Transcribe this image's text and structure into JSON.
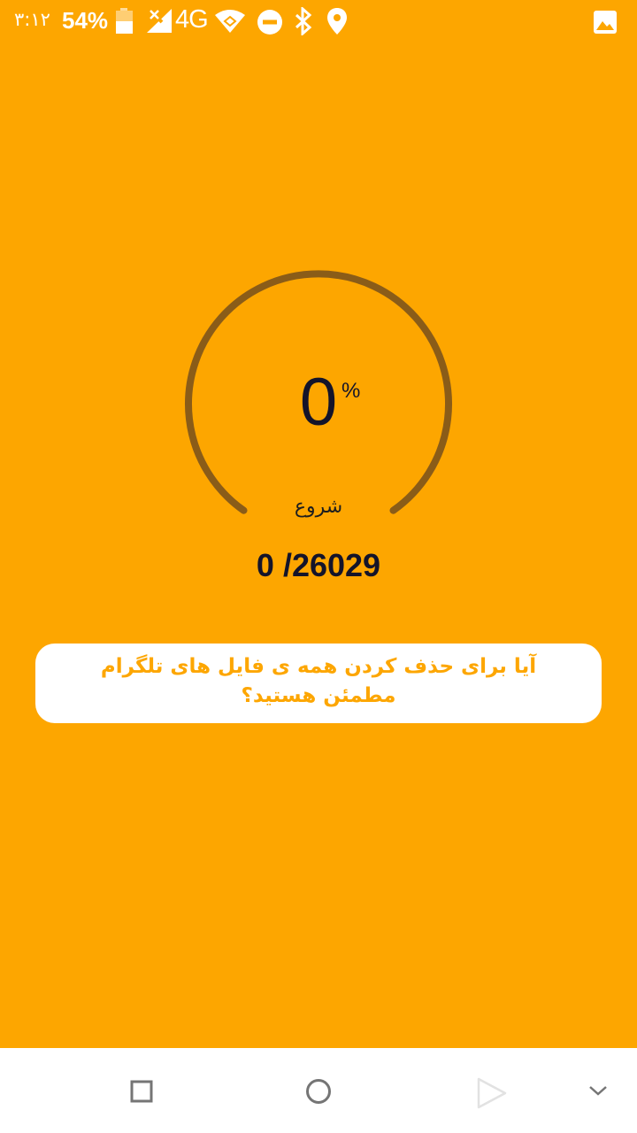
{
  "status_bar": {
    "time": "۳:۱۲",
    "battery_percent": "54%",
    "network_type": "4G",
    "icons": [
      "battery-icon",
      "no-signal-icon",
      "wifi-icon",
      "do-not-disturb-icon",
      "bluetooth-icon",
      "location-icon",
      "gallery-notification-icon"
    ]
  },
  "progress": {
    "percent_value": "0",
    "percent_sign": "%",
    "start_label": "شروع",
    "level": 0
  },
  "counter": {
    "text": "0 /26029"
  },
  "confirm": {
    "message": "آیا برای حذف کردن همه ی فایل های تلگرام مطمئن هستید؟"
  },
  "nav_bar": {
    "buttons": [
      "recents-square-icon",
      "home-circle-icon",
      "back-triangle-icon",
      "collapse-chevron-icon"
    ]
  },
  "colors": {
    "background": "#FDA600",
    "ring": "#8A5C18",
    "text_dark": "#14142A",
    "card": "#FFFFFF"
  }
}
